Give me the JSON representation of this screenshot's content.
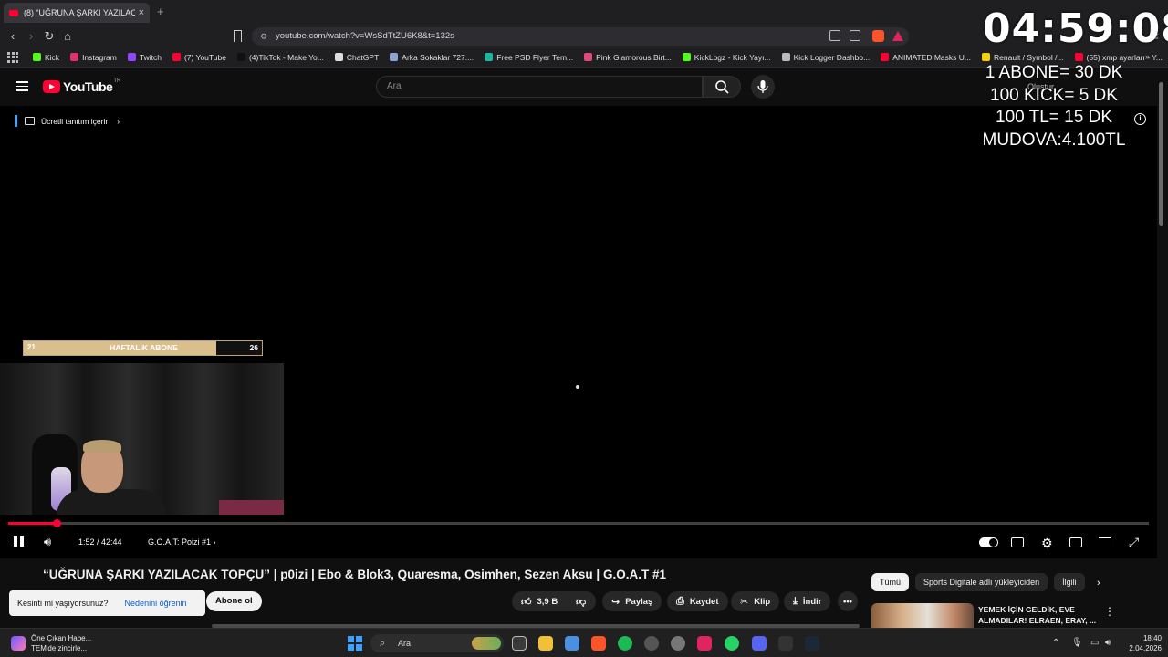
{
  "browser": {
    "tab_title": "(8) “UĞRUNA ŞARKI YAZILACAK",
    "tab_close": "×",
    "new_tab": "+",
    "url": "youtube.com/watch?v=WsSdTtZU6K8&t=132s",
    "bookmarks": [
      {
        "label": "Kick",
        "color": "#53fc18"
      },
      {
        "label": "Instagram",
        "color": "#e1306c"
      },
      {
        "label": "Twitch",
        "color": "#9146ff"
      },
      {
        "label": "(7) YouTube",
        "color": "#ff0033"
      },
      {
        "label": "(4)TikTok - Make Yo...",
        "color": "#111111"
      },
      {
        "label": "ChatGPT",
        "color": "#dddddd"
      },
      {
        "label": "Arka Sokaklar 727....",
        "color": "#8aa4d6"
      },
      {
        "label": "Free PSD Flyer Tem...",
        "color": "#1fb5a3"
      },
      {
        "label": "Pink Glamorous Birt...",
        "color": "#e04a7a"
      },
      {
        "label": "KickLogz - Kick Yayı...",
        "color": "#53fc18"
      },
      {
        "label": "Kick Logger Dashbo...",
        "color": "#bbbbbb"
      },
      {
        "label": "ANIMATED Masks U...",
        "color": "#ff0033"
      },
      {
        "label": "Renault / Symbol /...",
        "color": "#f5d000"
      },
      {
        "label": "(55) xmp ayarları - Y...",
        "color": "#ff0033"
      }
    ],
    "bookmarks_more": "»"
  },
  "youtube": {
    "logo_text": "YouTube",
    "logo_country": "TR",
    "search_placeholder": "Ara",
    "create_label": "Oluştur",
    "notification_count": "8"
  },
  "player": {
    "promo_text": "Ücretli tanıtım içerir",
    "weekly_subs": {
      "label": "HAFTALIK ABONE",
      "current": "21",
      "goal": "26",
      "fill_fraction": 0.81
    },
    "progress_fraction": 0.042,
    "time": "1:52 / 42:44",
    "chapter": "G.O.A.T: Poizi #1",
    "chapter_chevron": "›"
  },
  "overlay": {
    "timer": "04:59:08",
    "lines": [
      "1 ABONE= 30 DK",
      "100 KICK= 5 DK",
      "100 TL= 15 DK",
      "MUDOVA:4.100TL"
    ]
  },
  "video": {
    "title": "“UĞRUNA ŞARKI YAZILACAK TOPÇU” | p0izi | Ebo & Blok3, Quaresma, Osimhen, Sezen Aksu | G.O.A.T #1",
    "subscribe_label": "Abone ol",
    "toast_text": "Kesinti mi yaşıyorsunuz?",
    "toast_link": "Nedenini öğrenin",
    "actions": {
      "likes": "3,9 B",
      "share": "Paylaş",
      "save": "Kaydet",
      "clip": "Klip",
      "download": "İndir",
      "more": "•••"
    }
  },
  "sidebar": {
    "chips": [
      "Tümü",
      "Sports Digitale adlı yükleyiciden",
      "İlgili"
    ],
    "chips_next": "›",
    "recommendation_title": "YEMEK İÇİN GELDİK, EVE ALMADILAR! ELRAEN, ERAY, ...",
    "recommendation_more": "⋮"
  },
  "taskbar": {
    "news_title": "Öne Çıkan Habe...",
    "news_sub": "TEM'de zincirle...",
    "search_label": "Ara",
    "time": "18:40",
    "date": "2.04.2026"
  },
  "colors": {
    "accent_red": "#ff0033",
    "gold": "#d9bf8c",
    "link_blue": "#065fd4"
  }
}
